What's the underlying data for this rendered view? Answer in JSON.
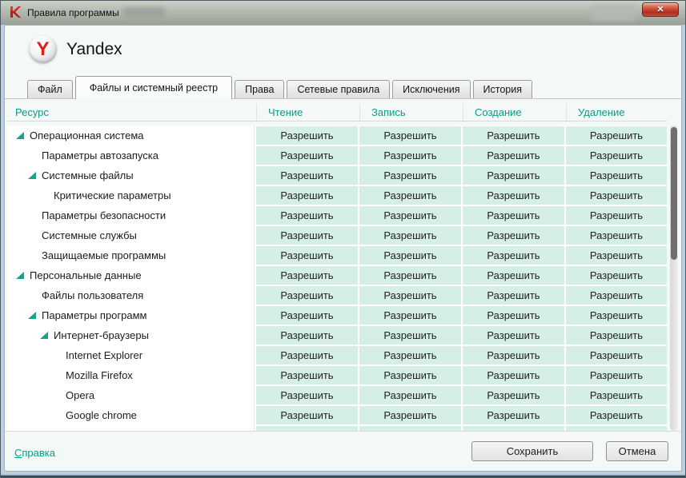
{
  "window": {
    "title": "Правила программы",
    "close_glyph": "✕"
  },
  "header": {
    "logo_letter": "Y",
    "app_name": "Yandex"
  },
  "tabs": [
    {
      "id": "tab-file",
      "label": "Файл",
      "active": false
    },
    {
      "id": "tab-files-and-registry",
      "label": "Файлы и системный реестр",
      "active": true
    },
    {
      "id": "tab-rights",
      "label": "Права",
      "active": false
    },
    {
      "id": "tab-network-rules",
      "label": "Сетевые правила",
      "active": false
    },
    {
      "id": "tab-exclusions",
      "label": "Исключения",
      "active": false
    },
    {
      "id": "tab-history",
      "label": "История",
      "active": false
    }
  ],
  "table": {
    "resource_header": "Ресурс",
    "columns": [
      "Чтение",
      "Запись",
      "Создание",
      "Удаление"
    ],
    "rows": [
      {
        "label": "Операционная система",
        "level": 0,
        "expandable": true,
        "permissions": [
          "Разрешить",
          "Разрешить",
          "Разрешить",
          "Разрешить"
        ]
      },
      {
        "label": "Параметры автозапуска",
        "level": 1,
        "expandable": false,
        "permissions": [
          "Разрешить",
          "Разрешить",
          "Разрешить",
          "Разрешить"
        ]
      },
      {
        "label": "Системные файлы",
        "level": 1,
        "expandable": true,
        "permissions": [
          "Разрешить",
          "Разрешить",
          "Разрешить",
          "Разрешить"
        ]
      },
      {
        "label": "Критические параметры",
        "level": 2,
        "expandable": false,
        "permissions": [
          "Разрешить",
          "Разрешить",
          "Разрешить",
          "Разрешить"
        ]
      },
      {
        "label": "Параметры безопасности",
        "level": 1,
        "expandable": false,
        "permissions": [
          "Разрешить",
          "Разрешить",
          "Разрешить",
          "Разрешить"
        ]
      },
      {
        "label": "Системные службы",
        "level": 1,
        "expandable": false,
        "permissions": [
          "Разрешить",
          "Разрешить",
          "Разрешить",
          "Разрешить"
        ]
      },
      {
        "label": "Защищаемые программы",
        "level": 1,
        "expandable": false,
        "permissions": [
          "Разрешить",
          "Разрешить",
          "Разрешить",
          "Разрешить"
        ]
      },
      {
        "label": "Персональные данные",
        "level": 0,
        "expandable": true,
        "permissions": [
          "Разрешить",
          "Разрешить",
          "Разрешить",
          "Разрешить"
        ]
      },
      {
        "label": "Файлы пользователя",
        "level": 1,
        "expandable": false,
        "permissions": [
          "Разрешить",
          "Разрешить",
          "Разрешить",
          "Разрешить"
        ]
      },
      {
        "label": "Параметры программ",
        "level": 1,
        "expandable": true,
        "permissions": [
          "Разрешить",
          "Разрешить",
          "Разрешить",
          "Разрешить"
        ]
      },
      {
        "label": "Интернет-браузеры",
        "level": 2,
        "expandable": true,
        "permissions": [
          "Разрешить",
          "Разрешить",
          "Разрешить",
          "Разрешить"
        ]
      },
      {
        "label": "Internet Explorer",
        "level": 3,
        "expandable": false,
        "permissions": [
          "Разрешить",
          "Разрешить",
          "Разрешить",
          "Разрешить"
        ]
      },
      {
        "label": "Mozilla Firefox",
        "level": 3,
        "expandable": false,
        "permissions": [
          "Разрешить",
          "Разрешить",
          "Разрешить",
          "Разрешить"
        ]
      },
      {
        "label": "Opera",
        "level": 3,
        "expandable": false,
        "permissions": [
          "Разрешить",
          "Разрешить",
          "Разрешить",
          "Разрешить"
        ]
      },
      {
        "label": "Google chrome",
        "level": 3,
        "expandable": false,
        "permissions": [
          "Разрешить",
          "Разрешить",
          "Разрешить",
          "Разрешить"
        ]
      },
      {
        "label": "",
        "level": 0,
        "expandable": false,
        "partial": true,
        "permissions": [
          "",
          "",
          "",
          ""
        ]
      }
    ]
  },
  "footer": {
    "help_initial": "С",
    "help_rest": "правка",
    "save_label": "Сохранить",
    "cancel_label": "Отмена"
  },
  "colors": {
    "accent_teal": "#0a9b8a",
    "permission_cell_bg": "#d5eee6",
    "close_button_red": "#c24a33",
    "brand_red": "#e01e16"
  }
}
